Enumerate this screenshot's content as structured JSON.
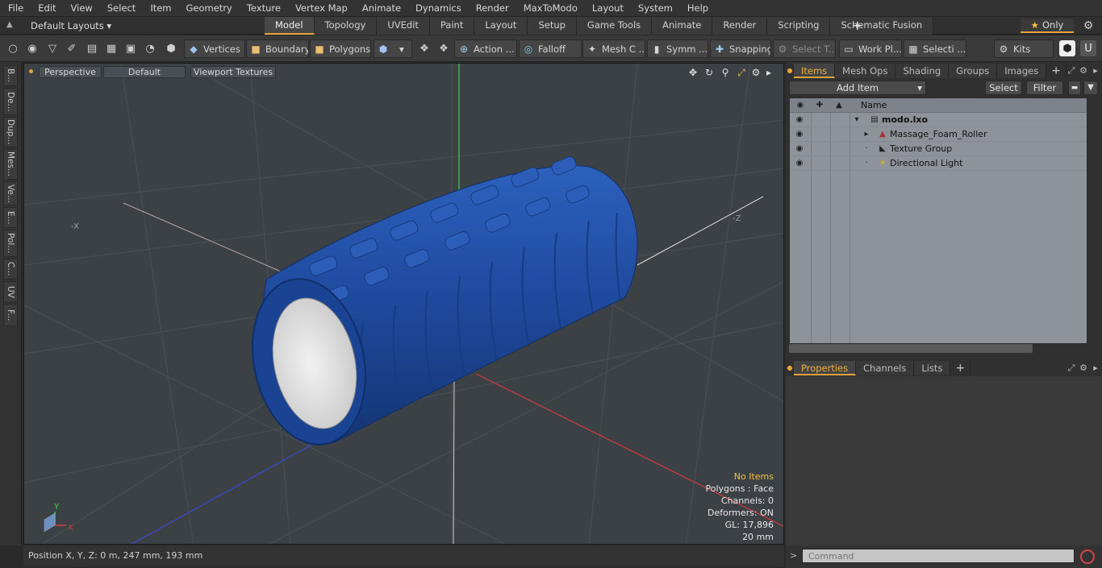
{
  "menu": [
    "File",
    "Edit",
    "View",
    "Select",
    "Item",
    "Geometry",
    "Texture",
    "Vertex Map",
    "Animate",
    "Dynamics",
    "Render",
    "MaxToModo",
    "Layout",
    "System",
    "Help"
  ],
  "layout": {
    "dropdown": "Default Layouts",
    "tabs": [
      "Model",
      "Topology",
      "UVEdit",
      "Paint",
      "Layout",
      "Setup",
      "Game Tools",
      "Animate",
      "Render",
      "Scripting",
      "Schematic Fusion"
    ],
    "active_tab": "Model",
    "only_label": "Only"
  },
  "toolbar": {
    "vertices": "Vertices",
    "boundary": "Boundary",
    "polygons": "Polygons",
    "action": "Action ...",
    "falloff": "Falloff",
    "mesh": "Mesh C ...",
    "symm": "Symm ...",
    "snapping": "Snapping",
    "select_t": "Select T...",
    "work_plane": "Work Pl...",
    "selecti": "Selecti ...",
    "kits": "Kits"
  },
  "left_tabs": [
    "B...",
    "De...",
    "Dup...",
    "Mes...",
    "Ve...",
    "E...",
    "Pol...",
    "C...",
    "UV",
    "F..."
  ],
  "viewport": {
    "view": "Perspective",
    "shading": "Default",
    "textures": "Viewport Textures",
    "axis_neg_x": "-X",
    "axis_neg_z": "-Z",
    "gizmo_y": "Y",
    "gizmo_x": "X",
    "info": {
      "selection": "No Items",
      "polygons": "Polygons : Face",
      "channels": "Channels: 0",
      "deformers": "Deformers: ON",
      "gl": "GL: 17,896",
      "scale": "20 mm"
    },
    "colors": {
      "object": "#1f4ba0",
      "inner": "#e6e6e6",
      "bg": "#3c4146"
    }
  },
  "status": {
    "position": "Position X, Y, Z:   0 m, 247 mm, 193 mm"
  },
  "items_panel": {
    "tabs": [
      "Items",
      "Mesh Ops",
      "Shading",
      "Groups",
      "Images"
    ],
    "active_tab": "Items",
    "add_item": "Add Item",
    "select": "Select",
    "filter": "Filter",
    "col_name": "Name",
    "rows": [
      {
        "label": "modo.lxo",
        "bold": true
      },
      {
        "label": "Massage_Foam_Roller",
        "bold": false
      },
      {
        "label": "Texture Group",
        "bold": false
      },
      {
        "label": "Directional Light",
        "bold": false
      }
    ]
  },
  "props_panel": {
    "tabs": [
      "Properties",
      "Channels",
      "Lists"
    ],
    "active_tab": "Properties"
  },
  "command": {
    "placeholder": "Command"
  }
}
